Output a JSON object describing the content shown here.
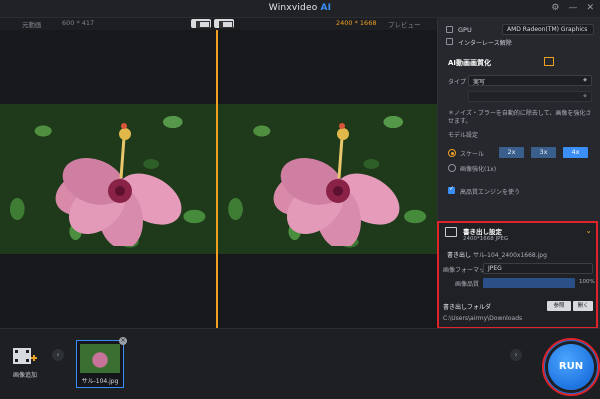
{
  "titlebar": {
    "app_name": "Winxvideo",
    "app_suffix": "AI",
    "settings_glyph": "⚙",
    "minimize_glyph": "—",
    "close_glyph": "✕"
  },
  "preview_header": {
    "original_label": "元動画",
    "original_size": "600 * 417",
    "output_size": "2400 * 1668",
    "preview_label": "プレビュー"
  },
  "gpu": {
    "label": "GPU",
    "selected": "AMD Radeon(TM) Graphics",
    "deinterlace_label": "インターレース解除"
  },
  "ai_section": {
    "title": "AI動画画質化",
    "type_label": "タイプ",
    "type_value": "実写",
    "description": "＊ノイズ・ブラーを自動的に除去して、画像を強化させます。",
    "model_label": "モデル設定",
    "scale_label": "スケール",
    "scales": [
      "2x",
      "3x",
      "4x"
    ],
    "selected_scale": "4x",
    "enhance_label": "画像強化(1x)",
    "hq_engine_label": "高品質エンジンを使う"
  },
  "export": {
    "title": "書き出し設定",
    "info": "2400*1668  JPEG",
    "name_label": "書き出し",
    "name_value": "サル-104_2400x1668.jpg",
    "format_label": "画像フォーマット",
    "format_value": "JPEG",
    "quality_label": "画像品質",
    "quality_value": "100%",
    "quality_fraction": 1.0,
    "folder_label": "書き出しフォルダ",
    "browse_label": "参照",
    "open_label": "開く",
    "folder_path": "C:\\Users\\airmy\\Downloads"
  },
  "bottom": {
    "add_label": "画像追加",
    "thumb_caption": "サル-104.jpg",
    "run_label": "RUN"
  },
  "colors": {
    "accent": "#3a8ef5",
    "highlight": "#e0232b",
    "divider": "#f0a020"
  }
}
